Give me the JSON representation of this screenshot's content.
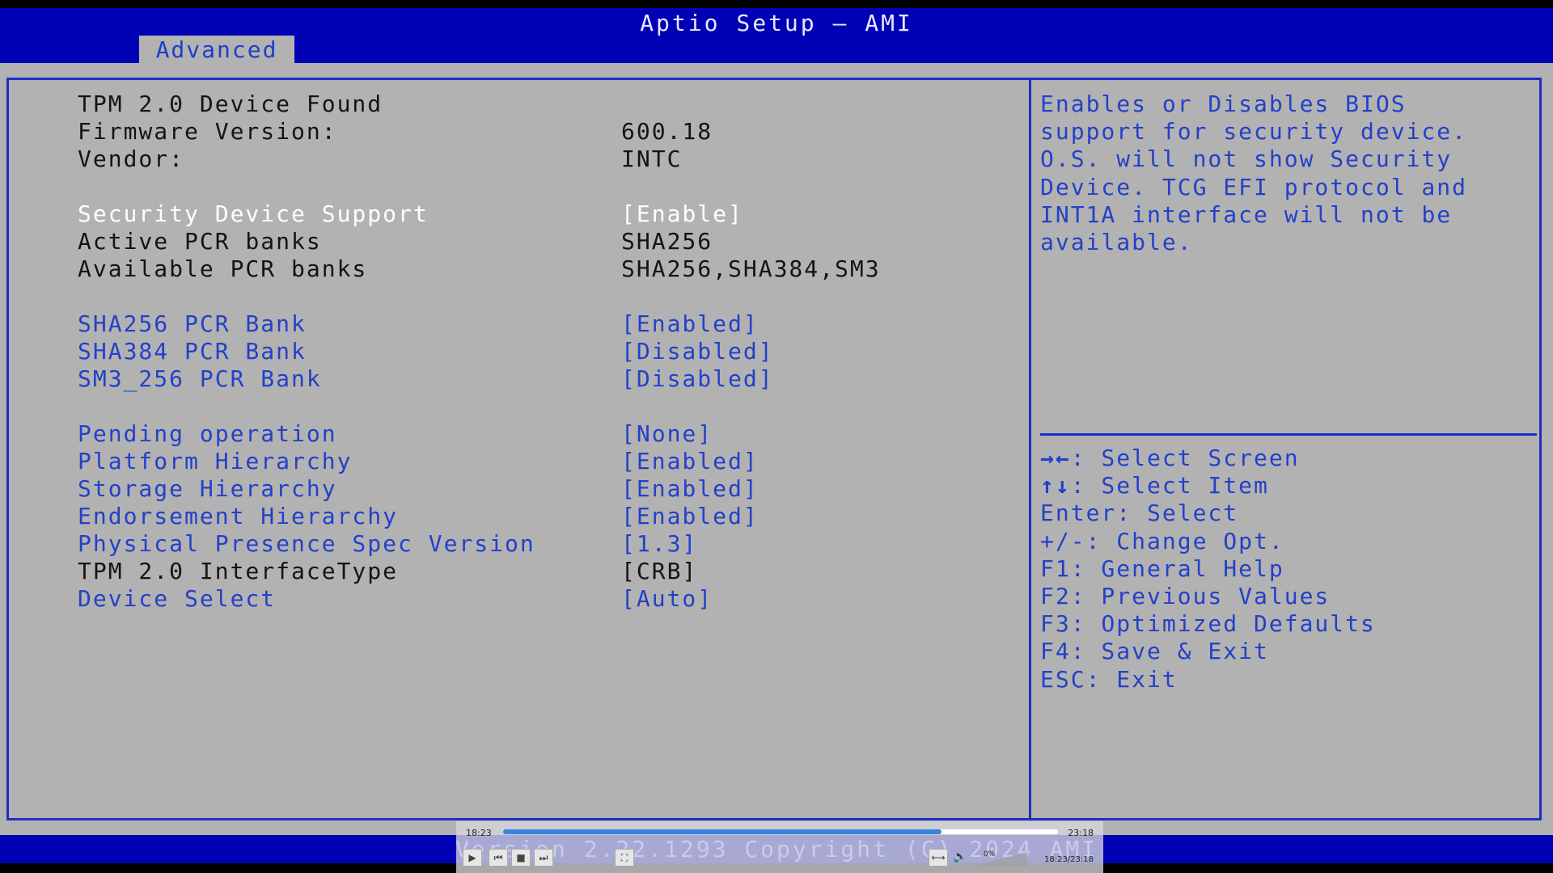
{
  "window": {
    "title": "Aptio Setup – AMI",
    "active_tab": "Advanced",
    "copyright": "Version 2.22.1293 Copyright (C) 2024 AMI"
  },
  "settings": [
    {
      "label": "TPM 2.0 Device Found",
      "value": "",
      "kind": "static"
    },
    {
      "label": "Firmware Version:",
      "value": "600.18",
      "kind": "static"
    },
    {
      "label": "Vendor:",
      "value": "INTC",
      "kind": "static"
    },
    {
      "label": "Security Device Support",
      "value": "[Enable]",
      "kind": "selected"
    },
    {
      "label": "Active PCR banks",
      "value": "SHA256",
      "kind": "static"
    },
    {
      "label": "Available PCR banks",
      "value": "SHA256,SHA384,SM3",
      "kind": "static"
    },
    {
      "label": "SHA256 PCR Bank",
      "value": "[Enabled]",
      "kind": "option"
    },
    {
      "label": "SHA384 PCR Bank",
      "value": "[Disabled]",
      "kind": "option"
    },
    {
      "label": "SM3_256 PCR Bank",
      "value": "[Disabled]",
      "kind": "option"
    },
    {
      "label": "Pending operation",
      "value": "[None]",
      "kind": "option"
    },
    {
      "label": "Platform Hierarchy",
      "value": "[Enabled]",
      "kind": "option"
    },
    {
      "label": "Storage Hierarchy",
      "value": "[Enabled]",
      "kind": "option"
    },
    {
      "label": "Endorsement Hierarchy",
      "value": "[Enabled]",
      "kind": "option"
    },
    {
      "label": "Physical Presence Spec Version",
      "value": "[1.3]",
      "kind": "option"
    },
    {
      "label": "TPM 2.0 InterfaceType",
      "value": "[CRB]",
      "kind": "static"
    },
    {
      "label": "Device Select",
      "value": "[Auto]",
      "kind": "option"
    }
  ],
  "help_text": "Enables or Disables BIOS\nsupport for security device.\nO.S. will not show Security\nDevice. TCG EFI protocol and\nINT1A interface will not be\navailable.",
  "key_help": [
    {
      "glyph": "→←",
      "text": ": Select Screen"
    },
    {
      "glyph": "↑↓",
      "text": ": Select Item"
    },
    {
      "glyph": "",
      "text": "Enter: Select"
    },
    {
      "glyph": "",
      "text": "+/-: Change Opt."
    },
    {
      "glyph": "",
      "text": "F1: General Help"
    },
    {
      "glyph": "",
      "text": "F2: Previous Values"
    },
    {
      "glyph": "",
      "text": "F3: Optimized Defaults"
    },
    {
      "glyph": "",
      "text": "F4: Save & Exit"
    },
    {
      "glyph": "",
      "text": "ESC: Exit"
    }
  ],
  "player": {
    "elapsed": "18:23",
    "total": "23:18",
    "progress_fraction": 0.79,
    "time_readout": "18:23/23:18",
    "volume_label": "0%",
    "controls": [
      "play-icon",
      "previous-icon",
      "stop-icon",
      "next-icon",
      "fullscreen-icon",
      "aspect-icon",
      "volume-icon"
    ]
  }
}
